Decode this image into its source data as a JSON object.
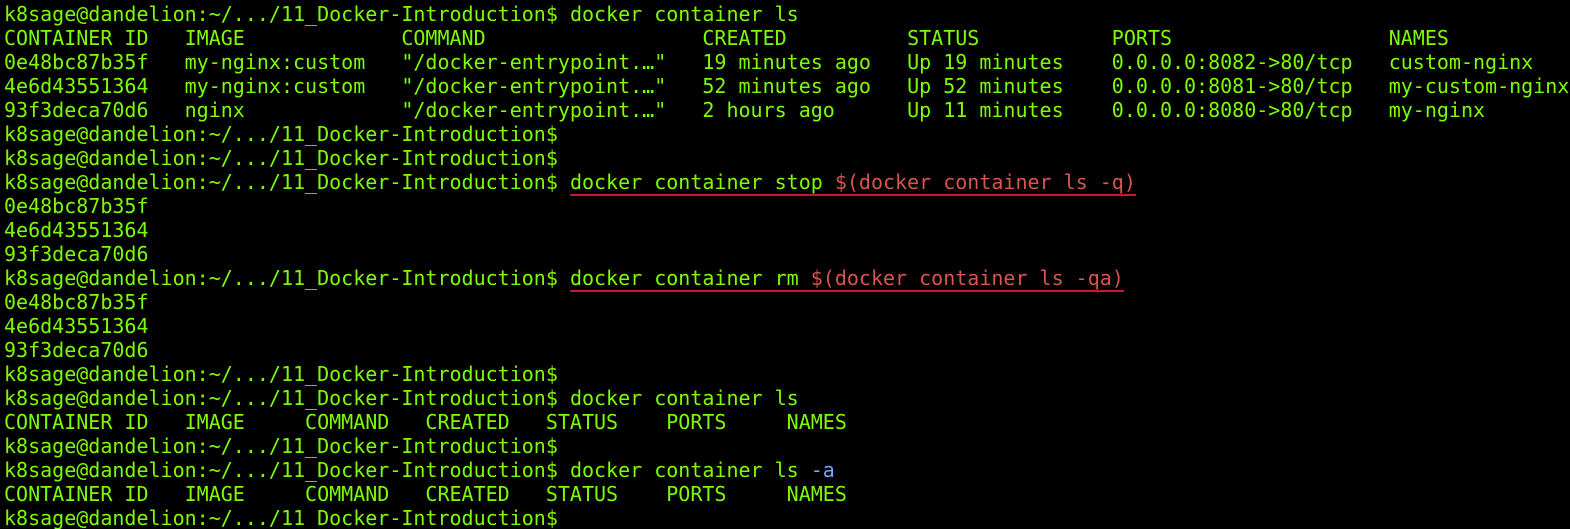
{
  "prompt": "k8sage@dandelion:~/.../11_Docker-Introduction$",
  "colors": {
    "text": "#7CFC00",
    "highlight": "#d9534f",
    "flag": "#6aa8ff",
    "underline": "#c9182b",
    "background": "#000000"
  },
  "cmd1": "docker container ls",
  "header1": "CONTAINER ID   IMAGE             COMMAND                  CREATED          STATUS           PORTS                  NAMES",
  "rows": [
    "0e48bc87b35f   my-nginx:custom   \"/docker-entrypoint.…\"   19 minutes ago   Up 19 minutes    0.0.0.0:8082->80/tcp   custom-nginx",
    "4e6d43551364   my-nginx:custom   \"/docker-entrypoint.…\"   52 minutes ago   Up 52 minutes    0.0.0.0:8081->80/tcp   my-custom-nginx",
    "93f3deca70d6   nginx             \"/docker-entrypoint.…\"   2 hours ago      Up 11 minutes    0.0.0.0:8080->80/tcp   my-nginx"
  ],
  "cmd_stop_prefix": "docker container stop ",
  "cmd_stop_sub": "$(docker container ls -q)",
  "stop_output": [
    "0e48bc87b35f",
    "4e6d43551364",
    "93f3deca70d6"
  ],
  "cmd_rm_prefix": "docker container rm ",
  "cmd_rm_sub": "$(docker container ls -qa)",
  "rm_output": [
    "0e48bc87b35f",
    "4e6d43551364",
    "93f3deca70d6"
  ],
  "cmd_ls": "docker container ls",
  "header_empty": "CONTAINER ID   IMAGE     COMMAND   CREATED   STATUS    PORTS     NAMES",
  "cmd_ls_a_prefix": "docker container ls ",
  "cmd_ls_a_flag": "-a"
}
